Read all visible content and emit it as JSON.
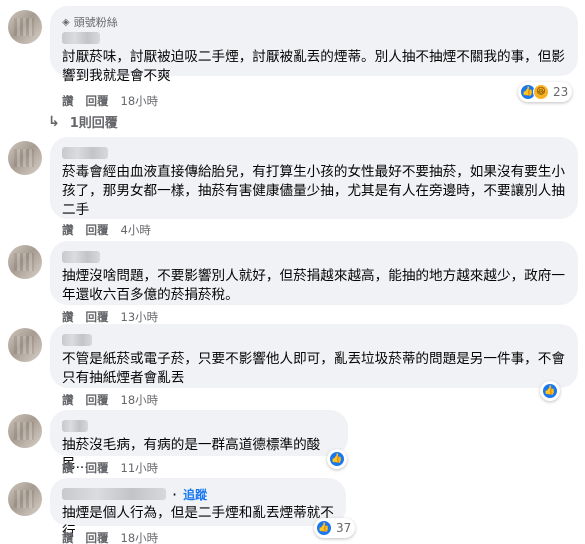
{
  "comments": [
    {
      "badge": "頭號粉絲",
      "text_lines": [
        "討厭菸味，討厭被迫吸二手煙，討厭被亂丟的煙蒂。別人抽不抽煙不關我的事，但影",
        "響到我就是會不爽"
      ],
      "actions": {
        "like": "讚",
        "reply": "回覆",
        "time": "18小時"
      },
      "reaction_count": "23",
      "replies_label": "1則回覆"
    },
    {
      "text_lines": [
        "菸毒會經由血液直接傳給胎兒，有打算生小孩的女性最好不要抽菸，如果沒有要生小",
        "孩了，那男女都一樣，抽菸有害健康儘量少抽，尤其是有人在旁邊時，不要讓別人抽",
        "二手"
      ],
      "actions": {
        "like": "讚",
        "reply": "回覆",
        "time": "4小時"
      }
    },
    {
      "text_lines": [
        "抽煙沒啥問題，不要影響別人就好，但菸捐越來越高，能抽的地方越來越少，政府一",
        "年還收六百多億的菸捐菸稅。"
      ],
      "actions": {
        "like": "讚",
        "reply": "回覆",
        "time": "13小時"
      }
    },
    {
      "text_lines": [
        "不管是紙菸或電子菸，只要不影響他人即可，亂丟垃圾菸蒂的問題是另一件事，不會",
        "只有抽紙煙者會亂丟"
      ],
      "actions": {
        "like": "讚",
        "reply": "回覆",
        "time": "18小時"
      }
    },
    {
      "text_lines": [
        "抽菸沒毛病，有病的是一群高道德標準的酸民..."
      ],
      "actions": {
        "like": "讚",
        "reply": "回覆",
        "time": "11小時"
      }
    },
    {
      "follow_label": "追蹤",
      "text_lines": [
        "抽煙是個人行為，但是二手煙和亂丟煙蒂就不行"
      ],
      "actions": {
        "like": "讚",
        "reply": "回覆",
        "time": "18小時"
      },
      "reaction_count": "37"
    }
  ],
  "colors": {
    "bubble": "#f0f2f5",
    "like_blue": "#1877f2",
    "meta_gray": "#65676b",
    "haha_yellow": "#f7b125"
  },
  "icons": {
    "badge": "diamond-badge-icon",
    "like": "like-thumb-icon",
    "haha": "haha-face-icon",
    "reply_arrow": "reply-arrow-icon"
  }
}
